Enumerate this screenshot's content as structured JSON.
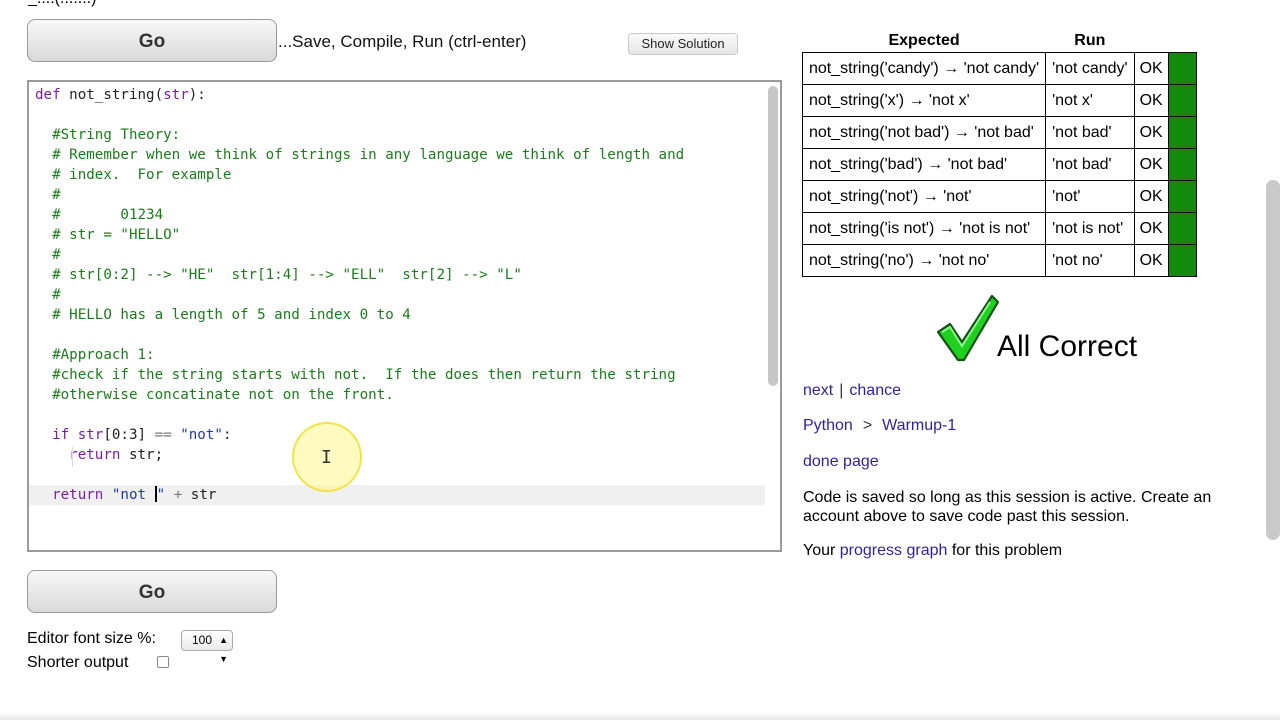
{
  "top_fragment": "_....(.......)",
  "go_label": "Go",
  "run_hint": "...Save, Compile, Run (ctrl-enter)",
  "show_solution_label": "Show Solution",
  "editor": {
    "lines": [
      [
        {
          "t": "def ",
          "c": "kw"
        },
        {
          "t": "not_string(",
          "c": "pl"
        },
        {
          "t": "str",
          "c": "kw"
        },
        {
          "t": "):",
          "c": "pl"
        }
      ],
      [],
      [
        {
          "t": "  #String Theory:",
          "c": "cm"
        }
      ],
      [
        {
          "t": "  # Remember when we think of strings in any language we think of length and",
          "c": "cm"
        }
      ],
      [
        {
          "t": "  # index.  For example",
          "c": "cm"
        }
      ],
      [
        {
          "t": "  #",
          "c": "cm"
        }
      ],
      [
        {
          "t": "  #       01234",
          "c": "cm"
        }
      ],
      [
        {
          "t": "  # str = \"HELLO\"",
          "c": "cm"
        }
      ],
      [
        {
          "t": "  #",
          "c": "cm"
        }
      ],
      [
        {
          "t": "  # str[0:2] --> \"HE\"  str[1:4] --> \"ELL\"  str[2] --> \"L\"",
          "c": "cm"
        }
      ],
      [
        {
          "t": "  #",
          "c": "cm"
        }
      ],
      [
        {
          "t": "  # HELLO has a length of 5 and index 0 to 4",
          "c": "cm"
        }
      ],
      [],
      [
        {
          "t": "  #Approach 1:",
          "c": "cm"
        }
      ],
      [
        {
          "t": "  #check if the string starts with not.  If the does then return the string",
          "c": "cm"
        }
      ],
      [
        {
          "t": "  #otherwise concatinate not on the front.",
          "c": "cm"
        }
      ],
      [],
      [
        {
          "t": "  ",
          "c": "pl"
        },
        {
          "t": "if ",
          "c": "kw"
        },
        {
          "t": "str",
          "c": "kw"
        },
        {
          "t": "[0:3] ",
          "c": "pl"
        },
        {
          "t": "== ",
          "c": "op"
        },
        {
          "t": "\"not\"",
          "c": "st"
        },
        {
          "t": ":",
          "c": "pl"
        }
      ],
      [
        {
          "t": "    ",
          "c": "pl"
        },
        {
          "t": "return ",
          "c": "kw"
        },
        {
          "t": "str;",
          "c": "pl"
        }
      ],
      [],
      [
        {
          "t": "  ",
          "c": "pl"
        },
        {
          "t": "return ",
          "c": "kw"
        },
        {
          "t": "\"not ",
          "c": "st"
        },
        {
          "t": "CURSOR",
          "c": "cursor"
        },
        {
          "t": "\" ",
          "c": "st"
        },
        {
          "t": "+ ",
          "c": "op"
        },
        {
          "t": "str",
          "c": "pl"
        }
      ]
    ],
    "active_line": 20
  },
  "font_size_label": "Editor font size %:",
  "font_size_value": "100",
  "shorter_output_label": "Shorter output",
  "results": {
    "headers": {
      "expected": "Expected",
      "run": "Run"
    },
    "rows": [
      {
        "expected": "not_string('candy') → 'not candy'",
        "run": "'not candy'",
        "status": "OK"
      },
      {
        "expected": "not_string('x') → 'not x'",
        "run": "'not x'",
        "status": "OK"
      },
      {
        "expected": "not_string('not bad') → 'not bad'",
        "run": "'not bad'",
        "status": "OK"
      },
      {
        "expected": "not_string('bad') → 'not bad'",
        "run": "'not bad'",
        "status": "OK"
      },
      {
        "expected": "not_string('not') → 'not'",
        "run": "'not'",
        "status": "OK"
      },
      {
        "expected": "not_string('is not') → 'not is not'",
        "run": "'not is not'",
        "status": "OK"
      },
      {
        "expected": "not_string('no') → 'not no'",
        "run": "'not no'",
        "status": "OK"
      }
    ],
    "ok_color": "#118a0e"
  },
  "all_correct": "All Correct",
  "nav": {
    "next": "next",
    "separator": "|",
    "chance": "chance"
  },
  "breadcrumb": {
    "python": "Python",
    "arrow": ">",
    "section": "Warmup-1"
  },
  "done_page": "done page",
  "saved_line1": "Code is saved so long as this session is active. Create an",
  "saved_line2": "account above to save code past this session.",
  "progress": {
    "prefix": "Your ",
    "link": "progress graph",
    "suffix": " for this problem"
  },
  "colors": {
    "link": "#331f99",
    "keyword": "#7a1fa2",
    "comment": "#1a7d1a",
    "string": "#1e3ba8"
  }
}
